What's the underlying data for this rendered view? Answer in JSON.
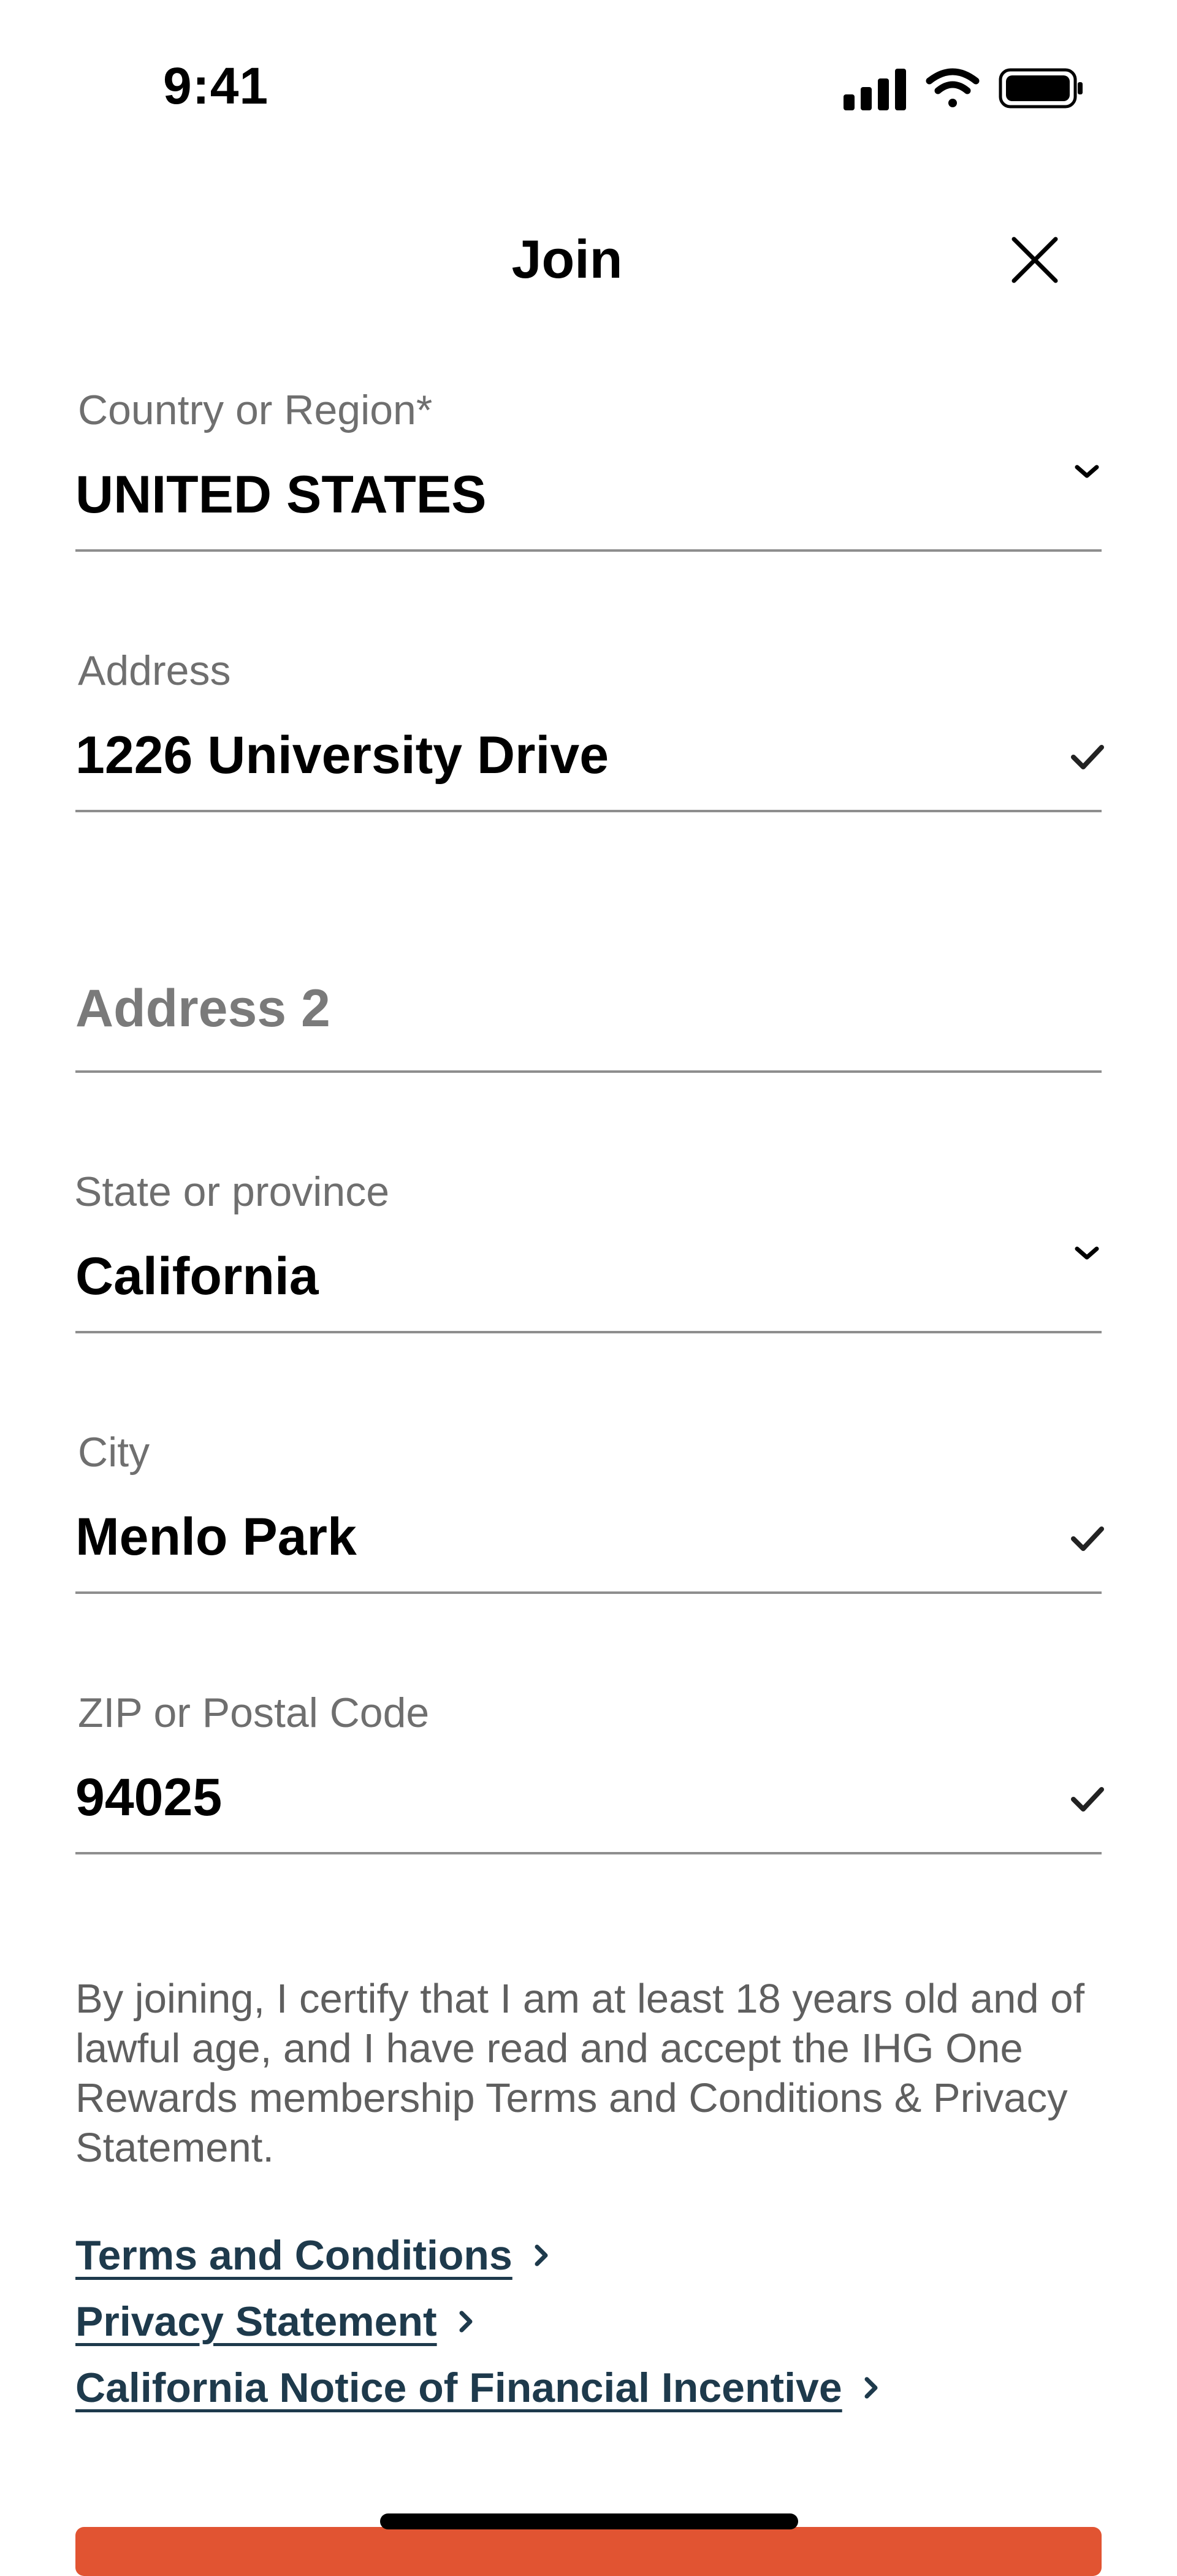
{
  "status_bar": {
    "time": "9:41",
    "icons": [
      "cellular-signal-icon",
      "wifi-icon",
      "battery-icon"
    ]
  },
  "header": {
    "title": "Join",
    "close_icon": "close-icon"
  },
  "form": {
    "country": {
      "label": "Country or Region*",
      "value": "UNITED STATES",
      "icon": "chevron-down-icon"
    },
    "address": {
      "label": "Address",
      "value": "1226 University Drive",
      "icon": "checkmark-icon"
    },
    "address2": {
      "placeholder": "Address 2",
      "value": ""
    },
    "state": {
      "label": "State or province",
      "value": "California",
      "icon": "chevron-down-icon"
    },
    "city": {
      "label": "City",
      "value": "Menlo Park",
      "icon": "checkmark-icon"
    },
    "zip": {
      "label": "ZIP or Postal Code",
      "value": "94025",
      "icon": "checkmark-icon"
    }
  },
  "disclaimer": "By joining, I certify that I am at least 18 years old and of lawful age, and I have read and accept the IHG One Rewards membership Terms and Conditions & Privacy Statement.",
  "links": [
    {
      "label": "Terms and Conditions"
    },
    {
      "label": "Privacy Statement"
    },
    {
      "label": "California Notice of Financial Incentive"
    }
  ],
  "colors": {
    "accent": "#e15432",
    "link": "#1e3a4c",
    "label": "#6f6f6f",
    "divider": "#8e8e8e"
  }
}
